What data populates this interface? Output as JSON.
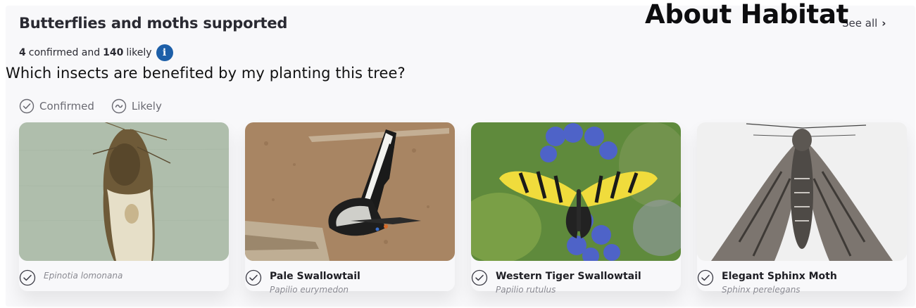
{
  "header": {
    "title": "Butterflies and moths supported",
    "overlay_heading": "About Habitat",
    "see_all_label": "See all",
    "confirmed_count": "4",
    "confirmed_text": "confirmed and",
    "likely_count": "140",
    "likely_text": "likely",
    "info_glyph": "i"
  },
  "question": "Which insects are benefited by my planting this tree?",
  "legend": {
    "confirmed_label": "Confirmed",
    "likely_label": "Likely"
  },
  "cards": [
    {
      "common_name": "",
      "scientific_name": "Epinotia lomonana",
      "status": "confirmed",
      "photo_icon": "moth-photo-icon"
    },
    {
      "common_name": "Pale Swallowtail",
      "scientific_name": "Papilio eurymedon",
      "status": "confirmed",
      "photo_icon": "butterfly-photo-icon"
    },
    {
      "common_name": "Western Tiger Swallowtail",
      "scientific_name": "Papilio rutulus",
      "status": "confirmed",
      "photo_icon": "butterfly-photo-icon"
    },
    {
      "common_name": "Elegant Sphinx Moth",
      "scientific_name": "Sphinx perelegans",
      "status": "confirmed",
      "photo_icon": "moth-photo-icon"
    }
  ],
  "colors": {
    "accent": "#1d5fa8",
    "panel": "#f8f8fa",
    "muted": "#8a8a92"
  }
}
